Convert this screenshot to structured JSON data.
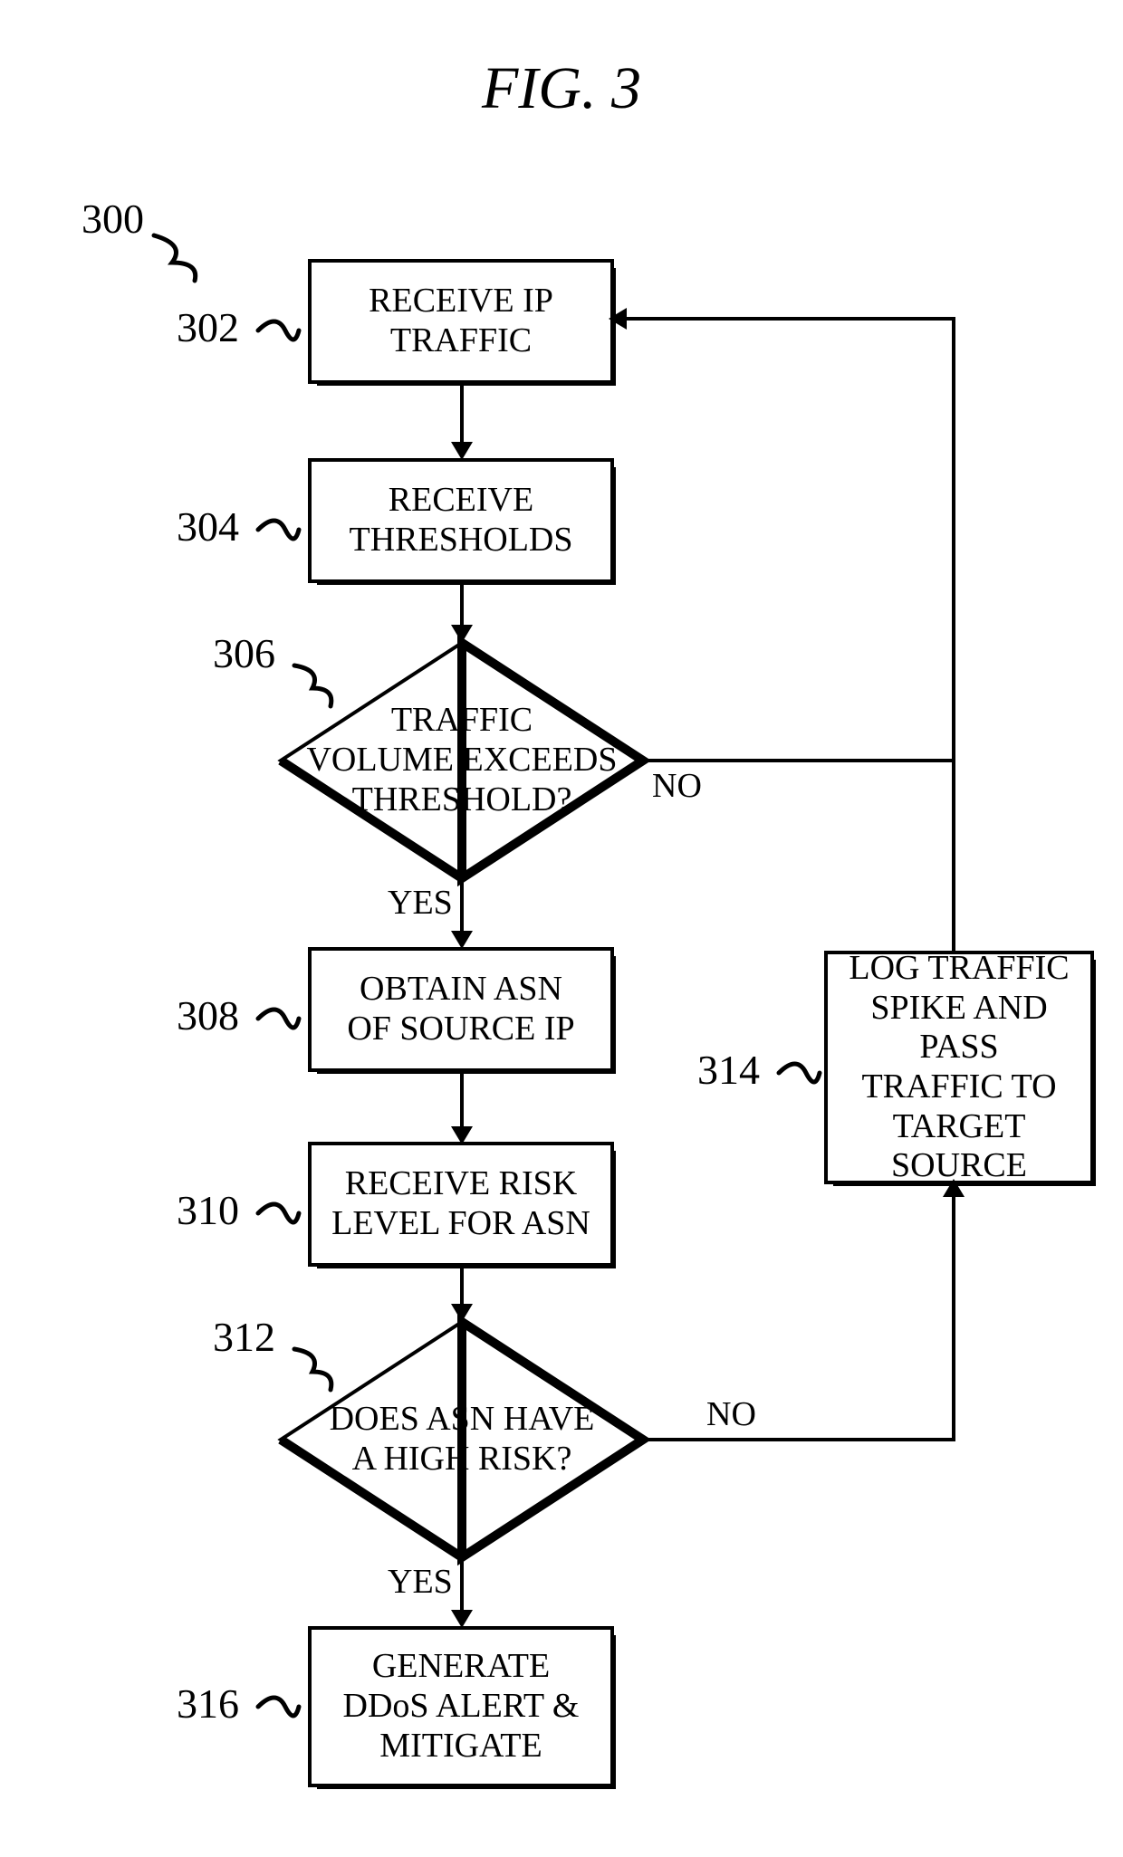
{
  "title": "FIG. 3",
  "labels": {
    "n300": "300",
    "n302": "302",
    "n304": "304",
    "n306": "306",
    "n308": "308",
    "n310": "310",
    "n312": "312",
    "n314": "314",
    "n316": "316"
  },
  "boxes": {
    "b302": "RECEIVE IP\nTRAFFIC",
    "b304": "RECEIVE\nTHRESHOLDS",
    "b308": "OBTAIN ASN\nOF SOURCE IP",
    "b310": "RECEIVE RISK\nLEVEL FOR ASN",
    "b314": "LOG TRAFFIC\nSPIKE AND PASS\nTRAFFIC TO\nTARGET SOURCE",
    "b316": "GENERATE\nDDoS ALERT &\nMITIGATE"
  },
  "decisions": {
    "d306": "TRAFFIC\nVOLUME EXCEEDS\nTHRESHOLD?",
    "d312": "DOES ASN HAVE\nA HIGH RISK?"
  },
  "edges": {
    "yes306": "YES",
    "no306": "NO",
    "yes312": "YES",
    "no312": "NO"
  }
}
